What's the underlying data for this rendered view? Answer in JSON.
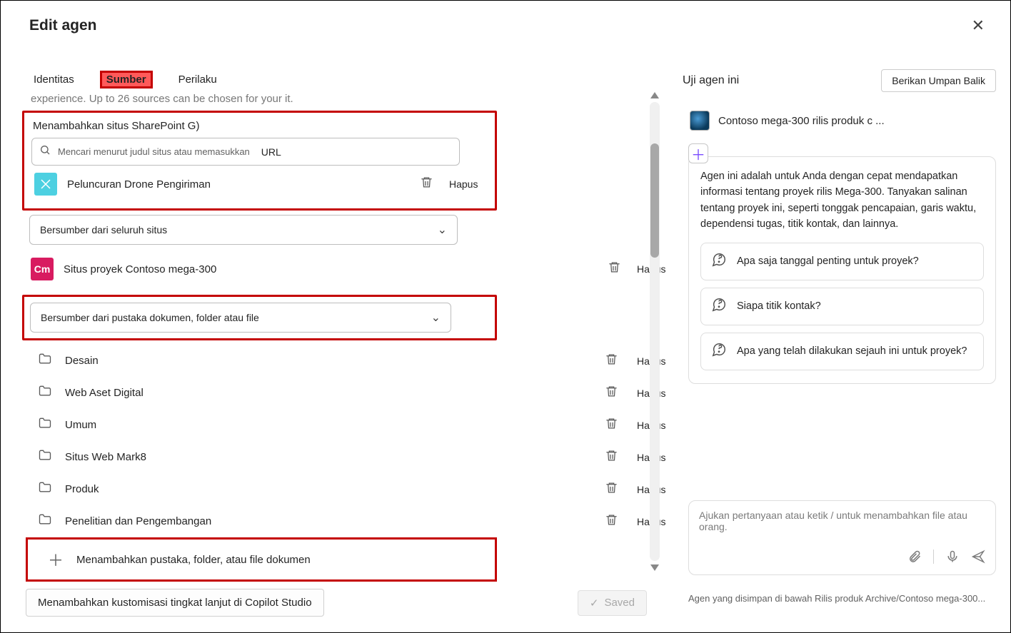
{
  "header": {
    "title": "Edit agen",
    "close_label": "Close"
  },
  "tabs": {
    "identity": "Identitas",
    "sources": "Sumber",
    "behavior": "Perilaku"
  },
  "right_header": {
    "test_label": "Uji agen ini",
    "feedback_label": "Berikan Umpan Balik"
  },
  "faded_top": "experience. Up to 26 sources can be chosen for your      it.",
  "add_site_section": {
    "title": "Menambahkan situs SharePoint G)",
    "search_placeholder": "Mencari menurut judul situs atau memasukkan",
    "url_label": "URL"
  },
  "site1": {
    "label": "Peluncuran Drone Pengiriman",
    "hapus": "Hapus"
  },
  "select1": "Bersumber dari seluruh situs",
  "site2": {
    "badge": "Cm",
    "label": "Situs proyek Contoso mega-300",
    "hapus": "Hapus"
  },
  "select2": "Bersumber dari pustaka dokumen, folder atau file",
  "folders": [
    {
      "label": "Desain",
      "hapus": "Hapus"
    },
    {
      "label": "Web Aset Digital",
      "hapus": "Hapus"
    },
    {
      "label": "Umum",
      "hapus": "Hapus"
    },
    {
      "label": "Situs Web Mark8",
      "hapus": "Hapus"
    },
    {
      "label": "Produk",
      "hapus": "Hapus"
    },
    {
      "label": "Penelitian dan Pengembangan",
      "hapus": "Hapus"
    }
  ],
  "add_library": "Menambahkan pustaka, folder, atau file dokumen",
  "bottom": {
    "advanced": "Menambahkan kustomisasi tingkat lanjut di Copilot Studio",
    "saved": "Saved"
  },
  "agent_chip": "Contoso mega-300 rilis produk c ...",
  "card": {
    "desc": "Agen ini adalah untuk Anda dengan cepat mendapatkan informasi tentang proyek rilis Mega-300. Tanyakan salinan tentang proyek ini, seperti tonggak pencapaian, garis waktu, dependensi tugas, titik kontak, dan lainnya.",
    "sugg1": "Apa saja tanggal penting untuk proyek?",
    "sugg2": "Siapa titik kontak?",
    "sugg3": "Apa yang telah dilakukan sejauh ini untuk proyek?"
  },
  "chat_placeholder": "Ajukan pertanyaan atau ketik / untuk menambahkan file atau orang.",
  "footer_note": "Agen yang disimpan di bawah Rilis produk Archive/Contoso mega-300..."
}
